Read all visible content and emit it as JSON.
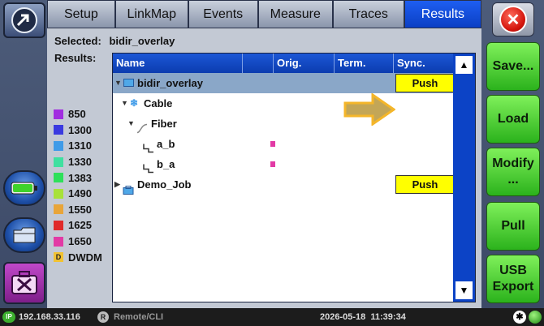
{
  "tabs": [
    {
      "label": "Setup",
      "active": false
    },
    {
      "label": "LinkMap",
      "active": false
    },
    {
      "label": "Events",
      "active": false
    },
    {
      "label": "Measure",
      "active": false
    },
    {
      "label": "Traces",
      "active": false
    },
    {
      "label": "Results",
      "active": true
    }
  ],
  "selected": {
    "label": "Selected:",
    "value": "bidir_overlay"
  },
  "results_label": "Results:",
  "table": {
    "headers": {
      "name": "Name",
      "orig": "Orig.",
      "term": "Term.",
      "sync": "Sync."
    },
    "rows": [
      {
        "name": "bidir_overlay",
        "icon": "folder-icon",
        "sync": "Push"
      },
      {
        "name": "Cable",
        "icon": "cable-icon"
      },
      {
        "name": "Fiber",
        "icon": "fiber-icon"
      },
      {
        "name": "a_b",
        "icon": "fiber-link-icon",
        "orig_color": "#e23aa5"
      },
      {
        "name": "b_a",
        "icon": "fiber-link-icon",
        "orig_color": "#e23aa5"
      },
      {
        "name": "Demo_Job",
        "icon": "job-icon",
        "sync": "Push"
      }
    ]
  },
  "legend": [
    {
      "label": "850",
      "color": "#a12ee0"
    },
    {
      "label": "1300",
      "color": "#3a3ae0"
    },
    {
      "label": "1310",
      "color": "#3f9be8"
    },
    {
      "label": "1330",
      "color": "#3fe0a0"
    },
    {
      "label": "1383",
      "color": "#2ee05a"
    },
    {
      "label": "1490",
      "color": "#a8e23a"
    },
    {
      "label": "1550",
      "color": "#e8a53a"
    },
    {
      "label": "1625",
      "color": "#e02a2a"
    },
    {
      "label": "1650",
      "color": "#e23aa5"
    },
    {
      "label": "DWDM",
      "color": "#f1c232",
      "badge": "D"
    }
  ],
  "buttons": {
    "save": "Save...",
    "load": "Load",
    "modify": "Modify\n...",
    "pull": "Pull",
    "usb_export": "USB\nExport"
  },
  "status": {
    "ip_badge": "IP",
    "ip": "192.168.33.116",
    "remote_badge": "R",
    "remote": "Remote/CLI",
    "datetime": "2026-05-18  11:39:34"
  },
  "colors": {
    "tab_active": "#1e5ef1",
    "push": "#ffff00",
    "action_green": "#2bb21c",
    "header_blue": "#0b3caf"
  }
}
